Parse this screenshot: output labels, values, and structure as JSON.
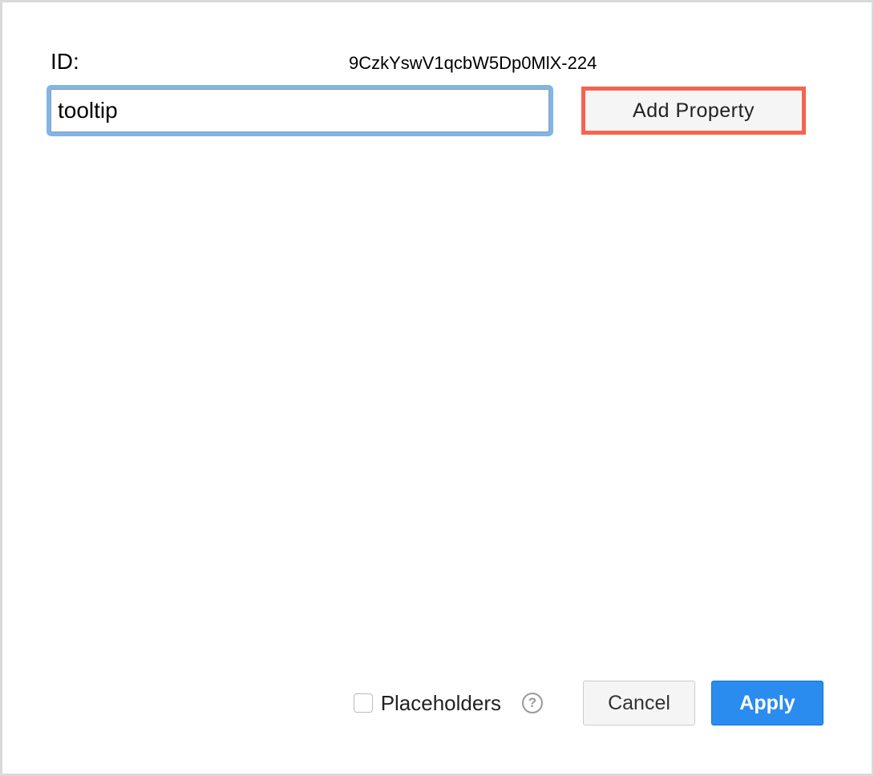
{
  "idLabel": "ID:",
  "idValue": "9CzkYswV1qcbW5Dp0MlX-224",
  "propertyInputValue": "tooltip",
  "addPropertyLabel": "Add Property",
  "placeholdersLabel": "Placeholders",
  "helpGlyph": "?",
  "cancelLabel": "Cancel",
  "applyLabel": "Apply"
}
